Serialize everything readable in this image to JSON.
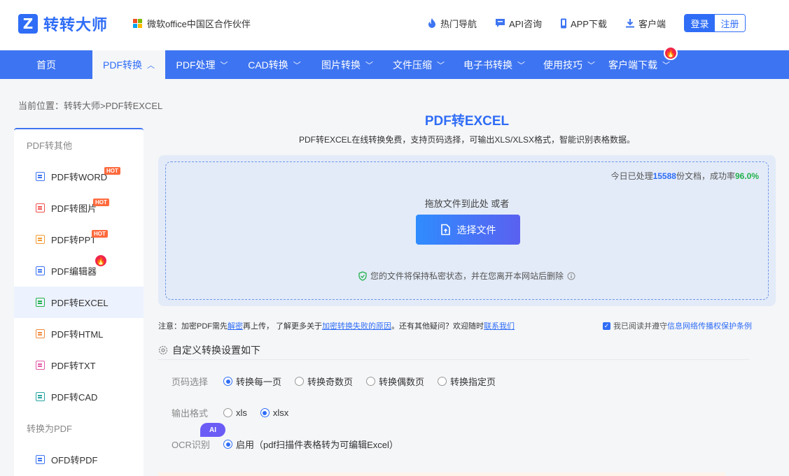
{
  "header": {
    "logo_mark": "Z",
    "logo_text": "转转大师",
    "partner": "微软office中国区合作伙伴",
    "links": [
      "热门导航",
      "API咨询",
      "APP下载",
      "客户端"
    ],
    "login": "登录",
    "register": "注册"
  },
  "nav": {
    "items": [
      "首页",
      "PDF转换",
      "PDF处理",
      "CAD转换",
      "图片转换",
      "文件压缩",
      "电子书转换",
      "使用技巧",
      "客户端下载"
    ],
    "chevron_up": "︿",
    "chevron_down": "﹀"
  },
  "breadcrumb": "当前位置：转转大师>PDF转EXCEL",
  "sidebar": {
    "group1": "PDF转其他",
    "items": [
      "PDF转WORD",
      "PDF转图片",
      "PDF转PPT",
      "PDF编辑器",
      "PDF转EXCEL",
      "PDF转HTML",
      "PDF转TXT",
      "PDF转CAD"
    ],
    "group2": "转换为PDF",
    "items2": [
      "OFD转PDF"
    ],
    "hot_label": "HOT",
    "active": "PDF转EXCEL"
  },
  "main": {
    "title": "PDF转EXCEL",
    "desc": "PDF转EXCEL在线转换免费，支持页码选择，可输出XLS/XLSX格式，智能识别表格数据。",
    "stats_prefix": "今日已处理",
    "stats_count": "15588",
    "stats_mid": "份文档，成功率",
    "stats_rate": "96.0%",
    "drop_hint": "拖放文件到此处 或者",
    "select_button": "选择文件",
    "privacy": "您的文件将保持私密状态，并在您离开本网站后删除"
  },
  "notice": {
    "t1": "注意：加密PDF需先",
    "l1": "解密",
    "t2": "再上传，  了解更多关于",
    "l2": "加密转换失败的原因",
    "t3": "。还有其他疑问？欢迎随时",
    "l3": "联系我们",
    "agree_text": "我已阅读并遵守",
    "agree_link": "信息网络传播权保护条例"
  },
  "settings": {
    "title": "自定义转换设置如下",
    "page_label": "页码选择",
    "page_options": [
      "转换每一页",
      "转换奇数页",
      "转换偶数页",
      "转换指定页"
    ],
    "format_label": "输出格式",
    "format_options": [
      "xls",
      "xlsx"
    ],
    "ocr_label": "OCR识别",
    "ocr_option": "启用（pdf扫描件表格转为可编辑Excel）",
    "ai_badge": "AI"
  },
  "colors": {
    "primary": "#2f6df6",
    "nav": "#3d74f1",
    "success": "#22b14c",
    "hot": "#ff6a3d",
    "fire": "#f0254a"
  }
}
